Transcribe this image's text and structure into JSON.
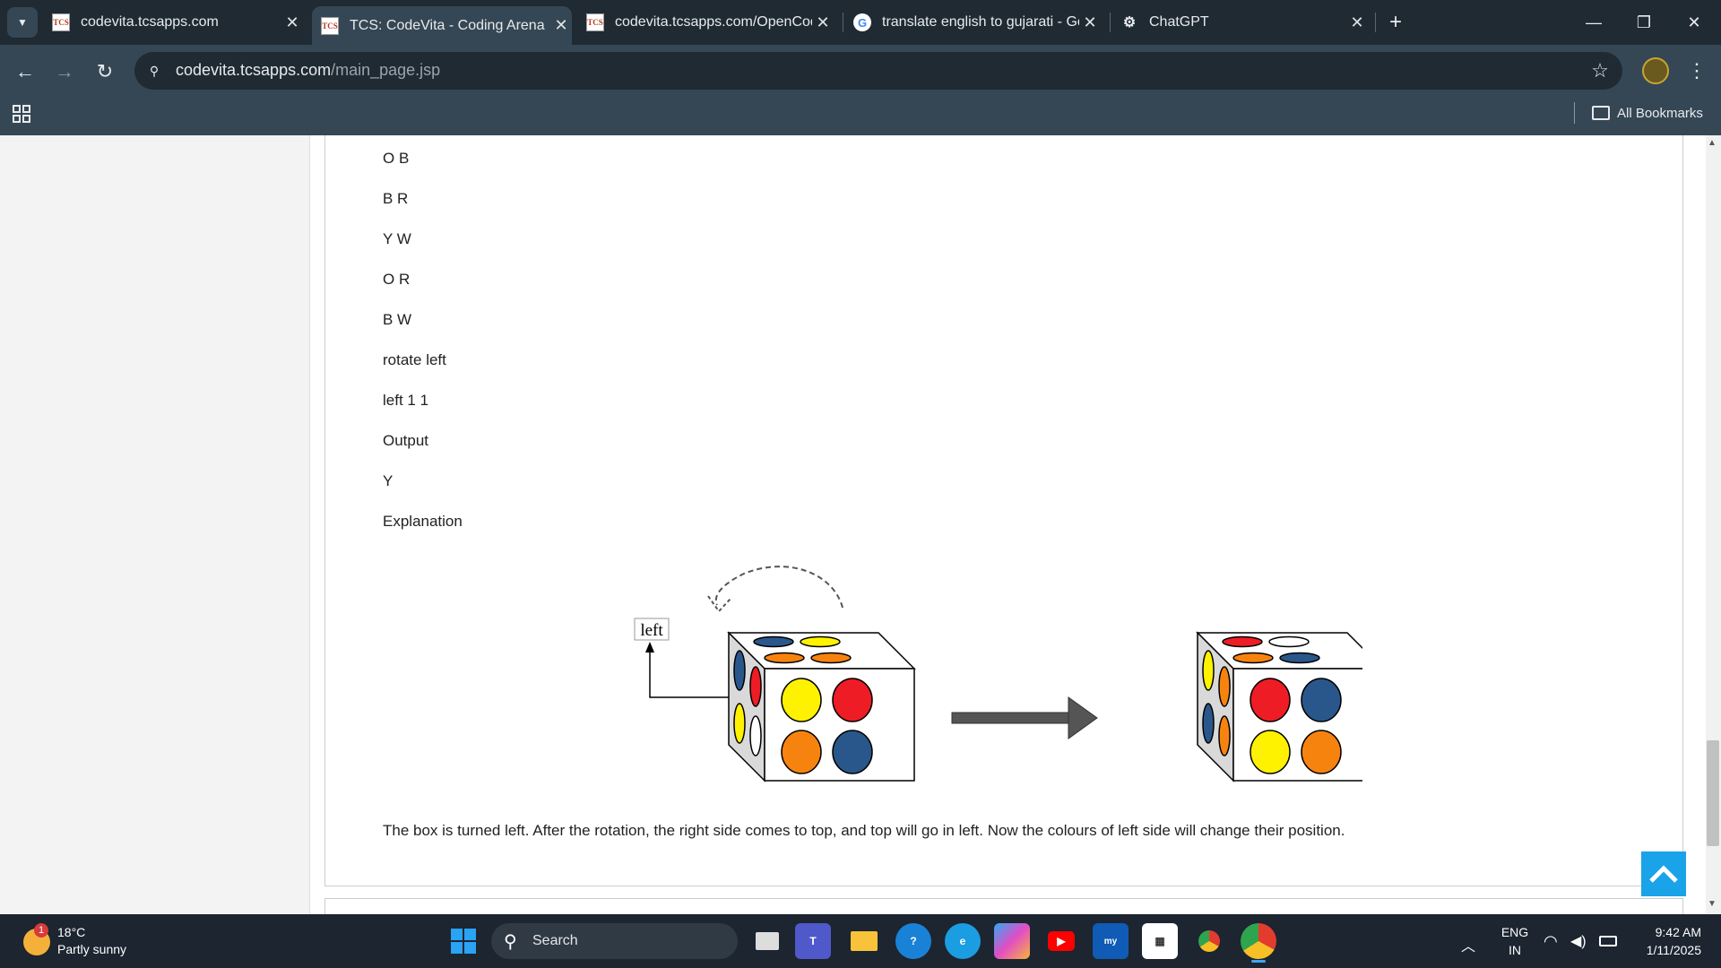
{
  "tabs": [
    {
      "title": "codevita.tcsapps.com",
      "icon": "tcs-icon"
    },
    {
      "title": "TCS: CodeVita - Coding Arena",
      "icon": "tcs-icon",
      "active": true
    },
    {
      "title": "codevita.tcsapps.com/OpenCod",
      "icon": "tcs-icon"
    },
    {
      "title": "translate english to gujarati - Go",
      "icon": "google-icon"
    },
    {
      "title": "ChatGPT",
      "icon": "chatgpt-icon"
    }
  ],
  "address": {
    "domain": "codevita.tcsapps.com",
    "path": "/main_page.jsp"
  },
  "bookmarks": {
    "label": "All Bookmarks"
  },
  "content": {
    "lines": [
      "O B",
      "B R",
      "Y W",
      "O R",
      "B W",
      "rotate left",
      "left 1 1",
      "Output",
      "Y",
      "Explanation"
    ],
    "diagram_label": "left",
    "explanation": "The box is turned left. After the rotation, the right side comes to top, and top will go in left. Now the colours of left side will change their position."
  },
  "colors": {
    "red": "#ee1c24",
    "blue": "#29578b",
    "yellow": "#fff200",
    "orange": "#f7830f",
    "white": "#ffffff",
    "accent": "#1aa3e8"
  },
  "cube_before": {
    "top": [
      "blue",
      "yellow",
      "orange",
      "orange"
    ],
    "left": [
      "blue",
      "red",
      "yellow",
      "white"
    ],
    "front": [
      "yellow",
      "red",
      "orange",
      "blue"
    ]
  },
  "cube_after": {
    "top": [
      "red",
      "white",
      "orange",
      "blue"
    ],
    "left": [
      "yellow",
      "orange",
      "blue",
      "orange"
    ],
    "front": [
      "red",
      "blue",
      "yellow",
      "orange"
    ]
  },
  "taskbar": {
    "weather_temp": "18°C",
    "weather_desc": "Partly sunny",
    "weather_badge": "1",
    "search_placeholder": "Search",
    "lang_1": "ENG",
    "lang_2": "IN",
    "time": "9:42 AM",
    "date": "1/11/2025"
  }
}
